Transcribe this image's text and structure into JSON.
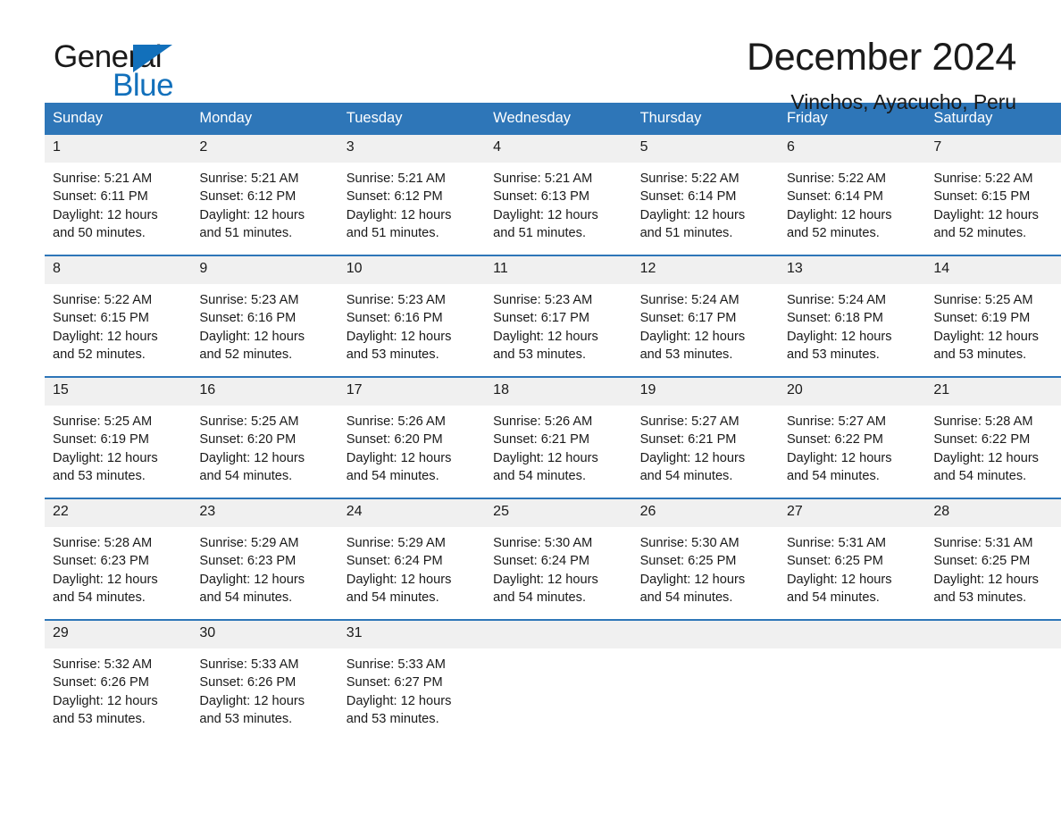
{
  "brand": {
    "name_top": "General",
    "name_bottom": "Blue",
    "accent_color": "#1270bb"
  },
  "header": {
    "title": "December 2024",
    "subtitle": "Vinchos, Ayacucho, Peru"
  },
  "theme": {
    "header_blue": "#2e76b8",
    "daynum_gray": "#f0f0f0"
  },
  "weekday_headers": [
    "Sunday",
    "Monday",
    "Tuesday",
    "Wednesday",
    "Thursday",
    "Friday",
    "Saturday"
  ],
  "weeks": [
    [
      {
        "day": "1",
        "sunrise": "Sunrise: 5:21 AM",
        "sunset": "Sunset: 6:11 PM",
        "daylight1": "Daylight: 12 hours",
        "daylight2": "and 50 minutes."
      },
      {
        "day": "2",
        "sunrise": "Sunrise: 5:21 AM",
        "sunset": "Sunset: 6:12 PM",
        "daylight1": "Daylight: 12 hours",
        "daylight2": "and 51 minutes."
      },
      {
        "day": "3",
        "sunrise": "Sunrise: 5:21 AM",
        "sunset": "Sunset: 6:12 PM",
        "daylight1": "Daylight: 12 hours",
        "daylight2": "and 51 minutes."
      },
      {
        "day": "4",
        "sunrise": "Sunrise: 5:21 AM",
        "sunset": "Sunset: 6:13 PM",
        "daylight1": "Daylight: 12 hours",
        "daylight2": "and 51 minutes."
      },
      {
        "day": "5",
        "sunrise": "Sunrise: 5:22 AM",
        "sunset": "Sunset: 6:14 PM",
        "daylight1": "Daylight: 12 hours",
        "daylight2": "and 51 minutes."
      },
      {
        "day": "6",
        "sunrise": "Sunrise: 5:22 AM",
        "sunset": "Sunset: 6:14 PM",
        "daylight1": "Daylight: 12 hours",
        "daylight2": "and 52 minutes."
      },
      {
        "day": "7",
        "sunrise": "Sunrise: 5:22 AM",
        "sunset": "Sunset: 6:15 PM",
        "daylight1": "Daylight: 12 hours",
        "daylight2": "and 52 minutes."
      }
    ],
    [
      {
        "day": "8",
        "sunrise": "Sunrise: 5:22 AM",
        "sunset": "Sunset: 6:15 PM",
        "daylight1": "Daylight: 12 hours",
        "daylight2": "and 52 minutes."
      },
      {
        "day": "9",
        "sunrise": "Sunrise: 5:23 AM",
        "sunset": "Sunset: 6:16 PM",
        "daylight1": "Daylight: 12 hours",
        "daylight2": "and 52 minutes."
      },
      {
        "day": "10",
        "sunrise": "Sunrise: 5:23 AM",
        "sunset": "Sunset: 6:16 PM",
        "daylight1": "Daylight: 12 hours",
        "daylight2": "and 53 minutes."
      },
      {
        "day": "11",
        "sunrise": "Sunrise: 5:23 AM",
        "sunset": "Sunset: 6:17 PM",
        "daylight1": "Daylight: 12 hours",
        "daylight2": "and 53 minutes."
      },
      {
        "day": "12",
        "sunrise": "Sunrise: 5:24 AM",
        "sunset": "Sunset: 6:17 PM",
        "daylight1": "Daylight: 12 hours",
        "daylight2": "and 53 minutes."
      },
      {
        "day": "13",
        "sunrise": "Sunrise: 5:24 AM",
        "sunset": "Sunset: 6:18 PM",
        "daylight1": "Daylight: 12 hours",
        "daylight2": "and 53 minutes."
      },
      {
        "day": "14",
        "sunrise": "Sunrise: 5:25 AM",
        "sunset": "Sunset: 6:19 PM",
        "daylight1": "Daylight: 12 hours",
        "daylight2": "and 53 minutes."
      }
    ],
    [
      {
        "day": "15",
        "sunrise": "Sunrise: 5:25 AM",
        "sunset": "Sunset: 6:19 PM",
        "daylight1": "Daylight: 12 hours",
        "daylight2": "and 53 minutes."
      },
      {
        "day": "16",
        "sunrise": "Sunrise: 5:25 AM",
        "sunset": "Sunset: 6:20 PM",
        "daylight1": "Daylight: 12 hours",
        "daylight2": "and 54 minutes."
      },
      {
        "day": "17",
        "sunrise": "Sunrise: 5:26 AM",
        "sunset": "Sunset: 6:20 PM",
        "daylight1": "Daylight: 12 hours",
        "daylight2": "and 54 minutes."
      },
      {
        "day": "18",
        "sunrise": "Sunrise: 5:26 AM",
        "sunset": "Sunset: 6:21 PM",
        "daylight1": "Daylight: 12 hours",
        "daylight2": "and 54 minutes."
      },
      {
        "day": "19",
        "sunrise": "Sunrise: 5:27 AM",
        "sunset": "Sunset: 6:21 PM",
        "daylight1": "Daylight: 12 hours",
        "daylight2": "and 54 minutes."
      },
      {
        "day": "20",
        "sunrise": "Sunrise: 5:27 AM",
        "sunset": "Sunset: 6:22 PM",
        "daylight1": "Daylight: 12 hours",
        "daylight2": "and 54 minutes."
      },
      {
        "day": "21",
        "sunrise": "Sunrise: 5:28 AM",
        "sunset": "Sunset: 6:22 PM",
        "daylight1": "Daylight: 12 hours",
        "daylight2": "and 54 minutes."
      }
    ],
    [
      {
        "day": "22",
        "sunrise": "Sunrise: 5:28 AM",
        "sunset": "Sunset: 6:23 PM",
        "daylight1": "Daylight: 12 hours",
        "daylight2": "and 54 minutes."
      },
      {
        "day": "23",
        "sunrise": "Sunrise: 5:29 AM",
        "sunset": "Sunset: 6:23 PM",
        "daylight1": "Daylight: 12 hours",
        "daylight2": "and 54 minutes."
      },
      {
        "day": "24",
        "sunrise": "Sunrise: 5:29 AM",
        "sunset": "Sunset: 6:24 PM",
        "daylight1": "Daylight: 12 hours",
        "daylight2": "and 54 minutes."
      },
      {
        "day": "25",
        "sunrise": "Sunrise: 5:30 AM",
        "sunset": "Sunset: 6:24 PM",
        "daylight1": "Daylight: 12 hours",
        "daylight2": "and 54 minutes."
      },
      {
        "day": "26",
        "sunrise": "Sunrise: 5:30 AM",
        "sunset": "Sunset: 6:25 PM",
        "daylight1": "Daylight: 12 hours",
        "daylight2": "and 54 minutes."
      },
      {
        "day": "27",
        "sunrise": "Sunrise: 5:31 AM",
        "sunset": "Sunset: 6:25 PM",
        "daylight1": "Daylight: 12 hours",
        "daylight2": "and 54 minutes."
      },
      {
        "day": "28",
        "sunrise": "Sunrise: 5:31 AM",
        "sunset": "Sunset: 6:25 PM",
        "daylight1": "Daylight: 12 hours",
        "daylight2": "and 53 minutes."
      }
    ],
    [
      {
        "day": "29",
        "sunrise": "Sunrise: 5:32 AM",
        "sunset": "Sunset: 6:26 PM",
        "daylight1": "Daylight: 12 hours",
        "daylight2": "and 53 minutes."
      },
      {
        "day": "30",
        "sunrise": "Sunrise: 5:33 AM",
        "sunset": "Sunset: 6:26 PM",
        "daylight1": "Daylight: 12 hours",
        "daylight2": "and 53 minutes."
      },
      {
        "day": "31",
        "sunrise": "Sunrise: 5:33 AM",
        "sunset": "Sunset: 6:27 PM",
        "daylight1": "Daylight: 12 hours",
        "daylight2": "and 53 minutes."
      },
      {
        "day": "",
        "sunrise": "",
        "sunset": "",
        "daylight1": "",
        "daylight2": ""
      },
      {
        "day": "",
        "sunrise": "",
        "sunset": "",
        "daylight1": "",
        "daylight2": ""
      },
      {
        "day": "",
        "sunrise": "",
        "sunset": "",
        "daylight1": "",
        "daylight2": ""
      },
      {
        "day": "",
        "sunrise": "",
        "sunset": "",
        "daylight1": "",
        "daylight2": ""
      }
    ]
  ]
}
